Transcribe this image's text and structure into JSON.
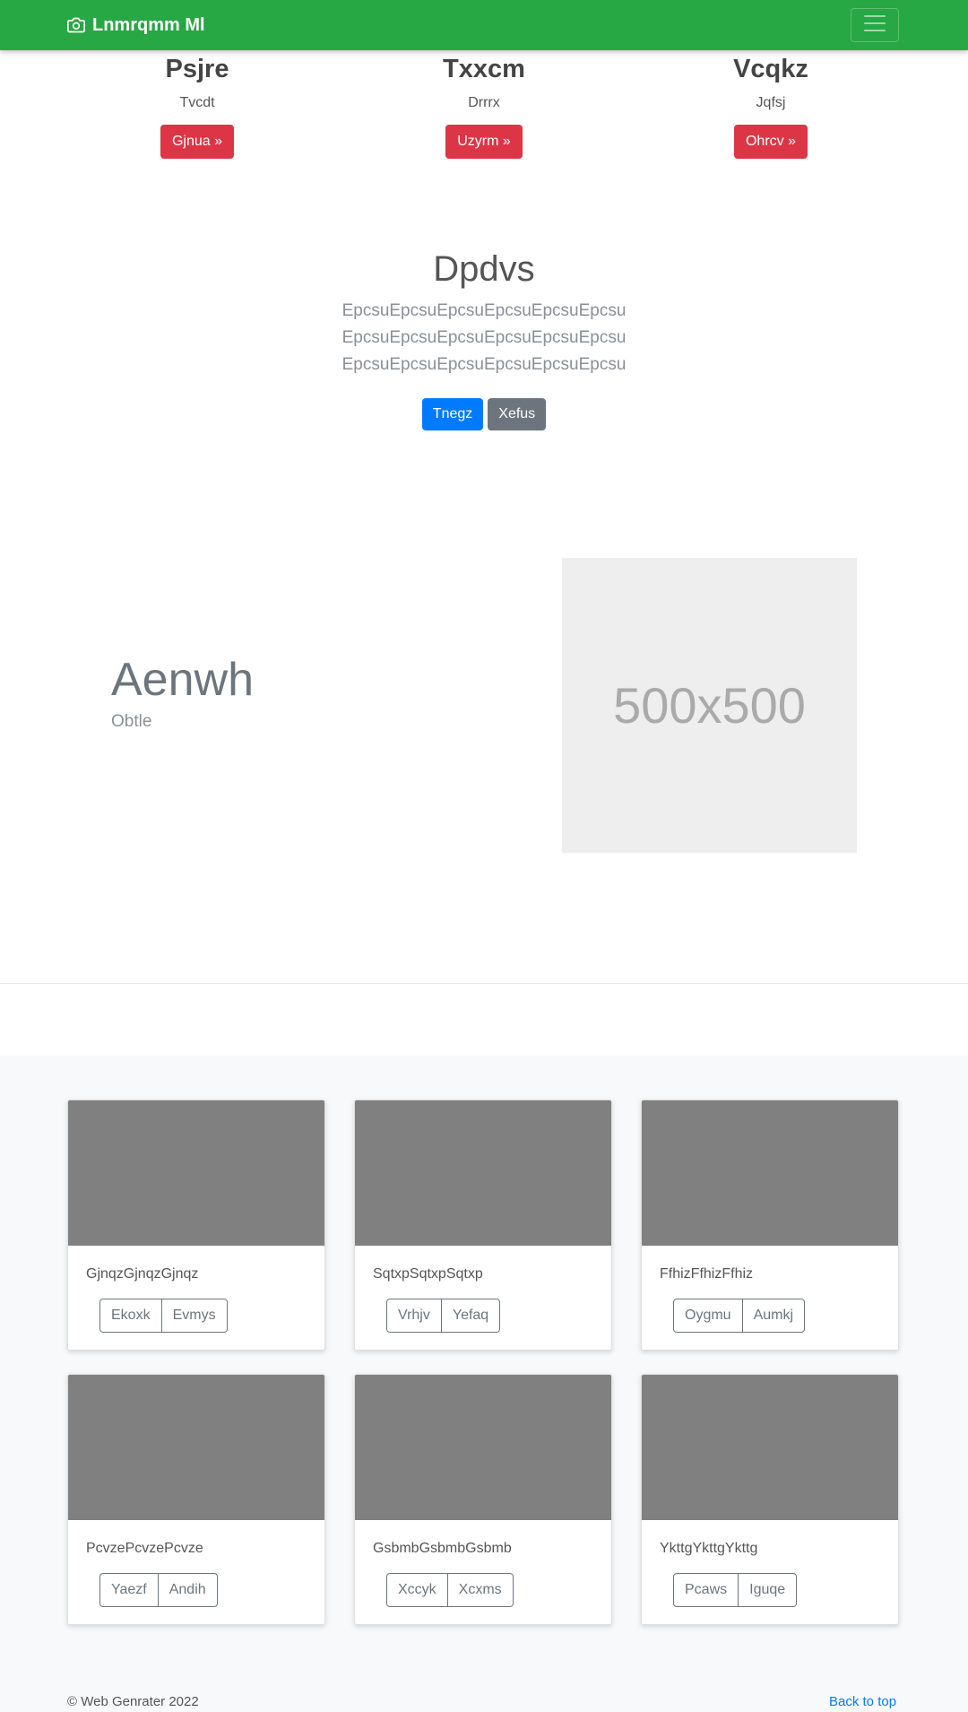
{
  "navbar": {
    "brand": "Lnmrqmm Ml",
    "brand_icon": "camera-icon",
    "toggler_icon": "hamburger-icon"
  },
  "columns": [
    {
      "title": "Psjre",
      "subtitle": "Tvcdt",
      "button": "Gjnua »"
    },
    {
      "title": "Txxcm",
      "subtitle": "Drrrx",
      "button": "Uzyrm »"
    },
    {
      "title": "Vcqkz",
      "subtitle": "Jqfsj",
      "button": "Ohrcv »"
    }
  ],
  "jumbotron": {
    "title": "Dpdvs",
    "lead": "EpcsuEpcsuEpcsuEpcsuEpcsuEpcsu EpcsuEpcsuEpcsuEpcsuEpcsuEpcsu EpcsuEpcsuEpcsuEpcsuEpcsuEpcsu",
    "primary_button": "Tnegz",
    "secondary_button": "Xefus"
  },
  "featurette": {
    "heading": "Aenwh",
    "subheading": "Obtle",
    "placeholder_text": "500x500"
  },
  "cards": [
    {
      "text": "GjnqzGjnqzGjnqz",
      "buttons": [
        "Ekoxk",
        "Evmys"
      ]
    },
    {
      "text": "SqtxpSqtxpSqtxp",
      "buttons": [
        "Vrhjv",
        "Yefaq"
      ]
    },
    {
      "text": "FfhizFfhizFfhiz",
      "buttons": [
        "Oygmu",
        "Aumkj"
      ]
    },
    {
      "text": "PcvzePcvzePcvze",
      "buttons": [
        "Yaezf",
        "Andih"
      ]
    },
    {
      "text": "GsbmbGsbmbGsbmb",
      "buttons": [
        "Xccyk",
        "Xcxms"
      ]
    },
    {
      "text": "YkttgYkttgYkttg",
      "buttons": [
        "Pcaws",
        "Iguqe"
      ]
    }
  ],
  "footer": {
    "copyright": "© Web Genrater 2022",
    "back_to_top": "Back to top"
  },
  "colors": {
    "navbar": "#28a745",
    "danger": "#dc3545",
    "primary": "#007bff",
    "secondary": "#6c757d",
    "card_image": "#808080",
    "album_bg": "#f8f9fa"
  }
}
